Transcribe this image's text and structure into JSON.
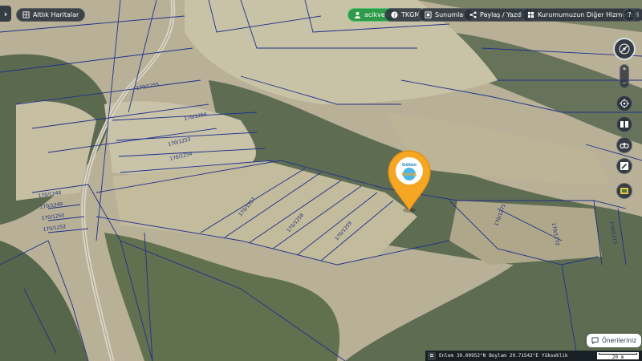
{
  "toolbar": {
    "sidebar_toggle": "›",
    "base_maps_label": "Altlık Haritalar",
    "user_label": "acikveri",
    "tkgm_label": "TKGM",
    "presentations_label": "Sunumlar",
    "share_print_label": "Paylaş / Yazdır",
    "other_services_label": "Kurumumuzun Diğer Hizmetleri",
    "help_label": "?"
  },
  "map": {
    "pin_logo_text_top": "Gölün",
    "pin_logo_text_bottom": "Emlak",
    "parcel_labels": [
      "170/1248",
      "170/1249",
      "170/1250",
      "170/1252",
      "170/1253",
      "170/1254",
      "170/1255",
      "170/1256",
      "170/1257",
      "170/1258",
      "170/1259",
      "170/1271",
      "170/1272",
      "170/1273"
    ]
  },
  "right_controls": {
    "zoom_in": "+",
    "zoom_out": "−"
  },
  "feedback": {
    "label": "Önerileriniz"
  },
  "status": {
    "lat_label": "Enlem",
    "lat_value": "39.00952°N",
    "lon_label": "Boylam",
    "lon_value": "29.71542°E",
    "elev_label": "Yükseklik",
    "scale_text": "20 m"
  },
  "colors": {
    "parcel_line": "#1f2f8c",
    "pin_orange": "#f5a623",
    "toolbar_bg": "#28303a",
    "user_green": "#2e9b4a"
  }
}
